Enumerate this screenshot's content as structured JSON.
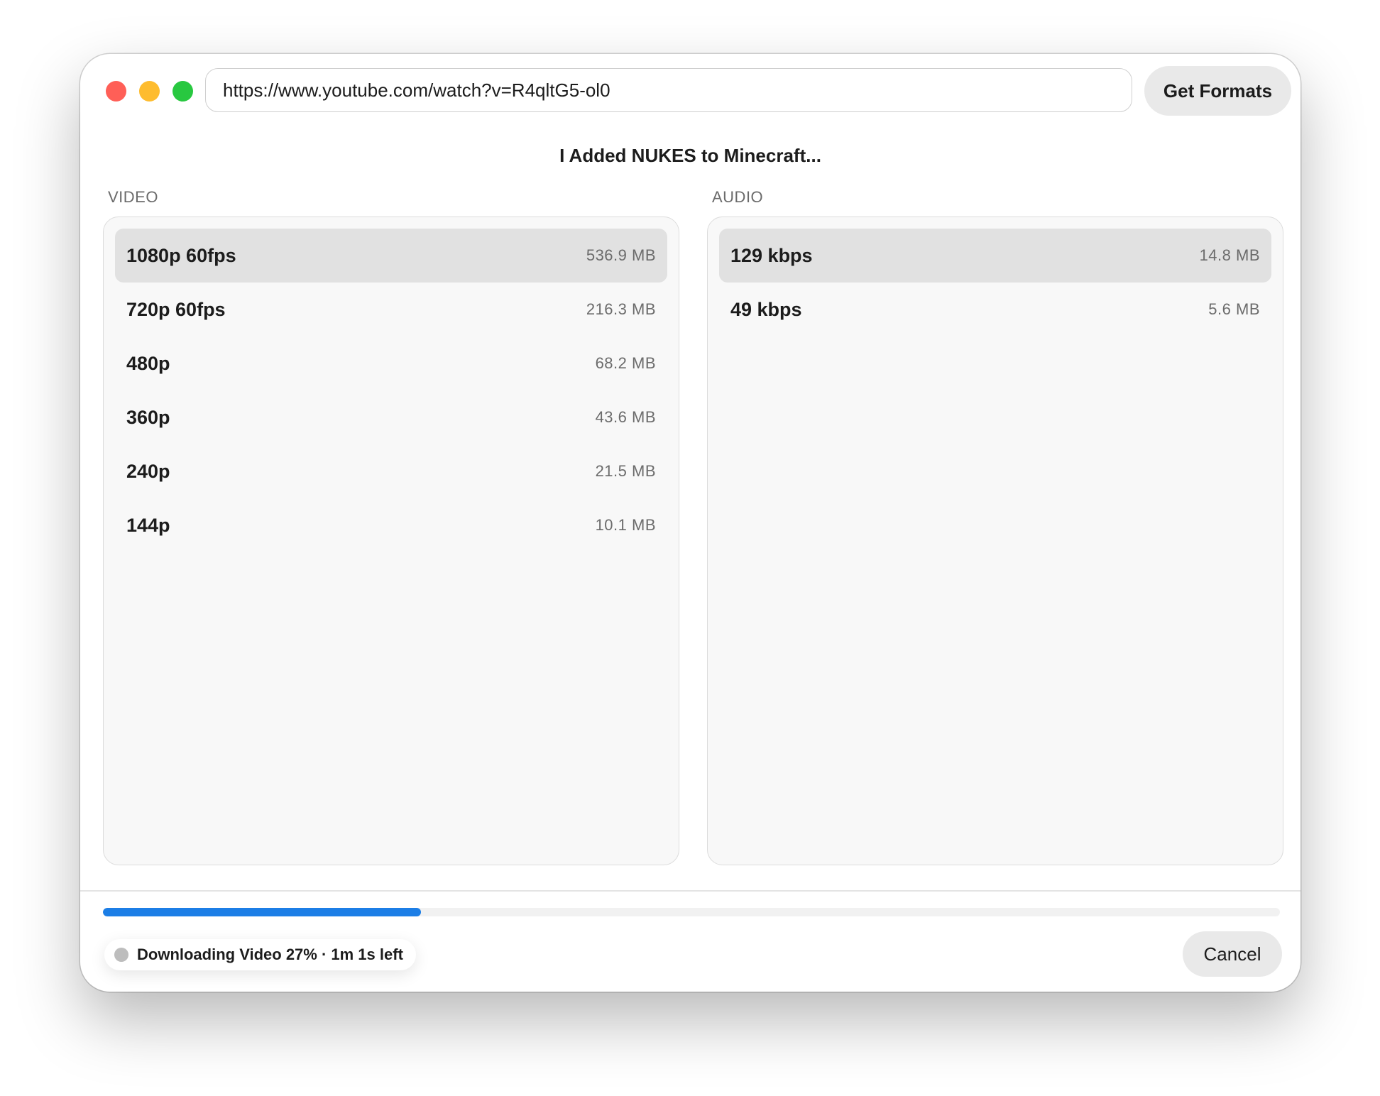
{
  "window": {
    "traffic_lights": [
      {
        "name": "close",
        "color": "#ff5f57"
      },
      {
        "name": "minimize",
        "color": "#febc2e"
      },
      {
        "name": "zoom",
        "color": "#28c840"
      }
    ]
  },
  "url_bar": {
    "value": "https://www.youtube.com/watch?v=R4qltG5-ol0",
    "button_label": "Get Formats"
  },
  "video_title": "I Added NUKES to Minecraft...",
  "video": {
    "label": "VIDEO",
    "formats": [
      {
        "label": "1080p 60fps",
        "size": "536.9 MB",
        "selected": true
      },
      {
        "label": "720p 60fps",
        "size": "216.3 MB",
        "selected": false
      },
      {
        "label": "480p",
        "size": "68.2 MB",
        "selected": false
      },
      {
        "label": "360p",
        "size": "43.6 MB",
        "selected": false
      },
      {
        "label": "240p",
        "size": "21.5 MB",
        "selected": false
      },
      {
        "label": "144p",
        "size": "10.1 MB",
        "selected": false
      }
    ]
  },
  "audio": {
    "label": "AUDIO",
    "formats": [
      {
        "label": "129 kbps",
        "size": "14.8 MB",
        "selected": true
      },
      {
        "label": "49 kbps",
        "size": "5.6 MB",
        "selected": false
      }
    ]
  },
  "progress": {
    "fraction": 0.27,
    "color": "#1c7ee6"
  },
  "status": {
    "text": "Downloading Video 27% · 1m 1s left",
    "dot_color": "#bdbdbd"
  },
  "cancel_label": "Cancel"
}
